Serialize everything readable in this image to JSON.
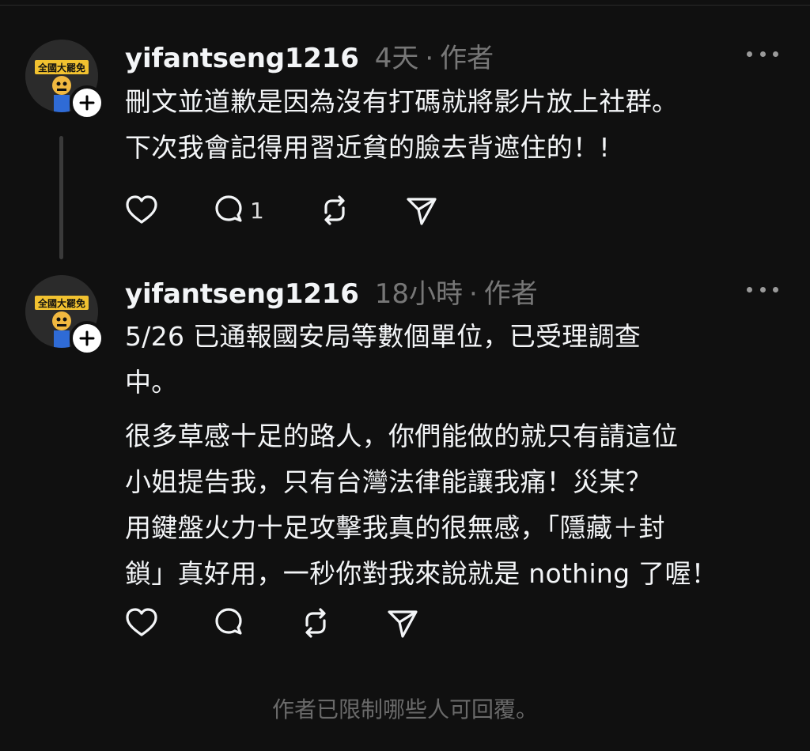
{
  "posts": [
    {
      "username": "yifantseng1216",
      "time": "4天",
      "separator": "·",
      "role": "作者",
      "lines": [
        "刪文並道歉是因為沒有打碼就將影片放上社群。",
        "下次我會記得用習近貧的臉去背遮住的！!"
      ],
      "reply_count": "1"
    },
    {
      "username": "yifantseng1216",
      "time": "18小時",
      "separator": "·",
      "role": "作者",
      "lines": [
        "5/26 已通報國安局等數個單位，已受理調查",
        "中。",
        "很多草感十足的路人，你們能做的就只有請這位",
        "小姐提告我，只有台灣法律能讓我痛！災某？",
        "用鍵盤火力十足攻擊我真的很無感，「隱藏＋封",
        "鎖」真好用，一秒你對我來說就是 nothing 了喔！"
      ],
      "reply_count": ""
    }
  ],
  "avatar_text": "全國大罷免",
  "footer": "作者已限制哪些人可回覆。",
  "icons": [
    "heart-icon",
    "reply-icon",
    "repost-icon",
    "share-icon",
    "plus-icon",
    "more-icon"
  ],
  "colors": {
    "background": "#101010",
    "text": "#f3f5f7",
    "muted": "#777777"
  }
}
